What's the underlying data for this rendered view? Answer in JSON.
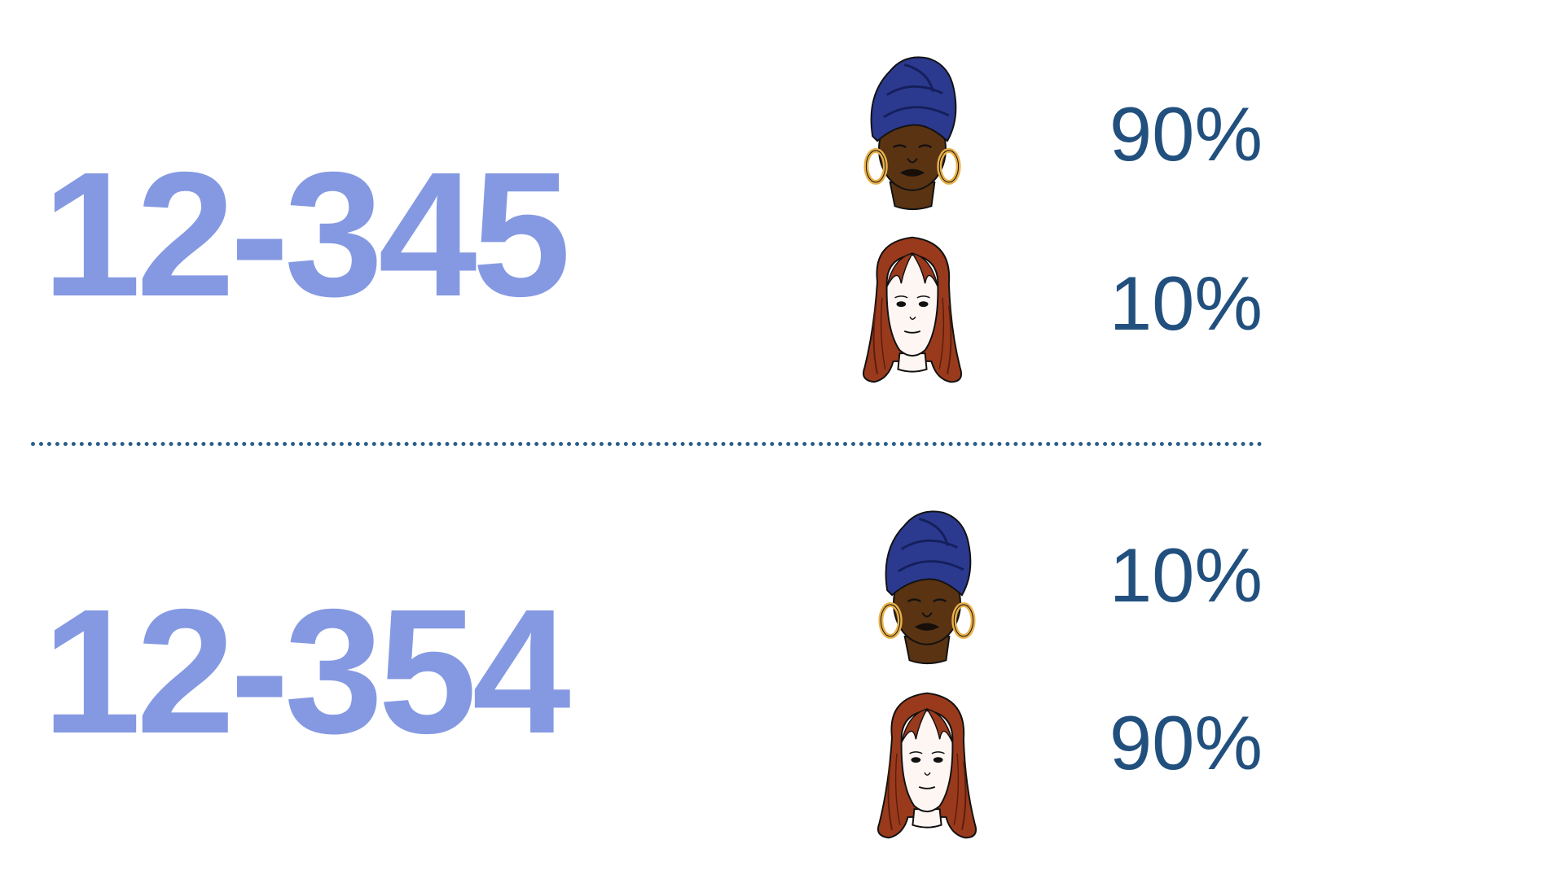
{
  "colors": {
    "code": "#8599e2",
    "percent": "#22507e",
    "divider": "#2b5f8a",
    "turban": "#2b3a8f",
    "dark_skin": "#5a3312",
    "light_skin": "#fdf6f3",
    "red_hair": "#9a3a1c",
    "earring": "#e8b04a"
  },
  "groups": [
    {
      "code": "12-345",
      "rows": [
        {
          "face": "turban-woman-face-icon",
          "percent": "90%"
        },
        {
          "face": "red-haired-woman-face-icon",
          "percent": "10%"
        }
      ]
    },
    {
      "code": "12-354",
      "rows": [
        {
          "face": "turban-woman-face-icon",
          "percent": "10%"
        },
        {
          "face": "red-haired-woman-face-icon",
          "percent": "90%"
        }
      ]
    }
  ]
}
